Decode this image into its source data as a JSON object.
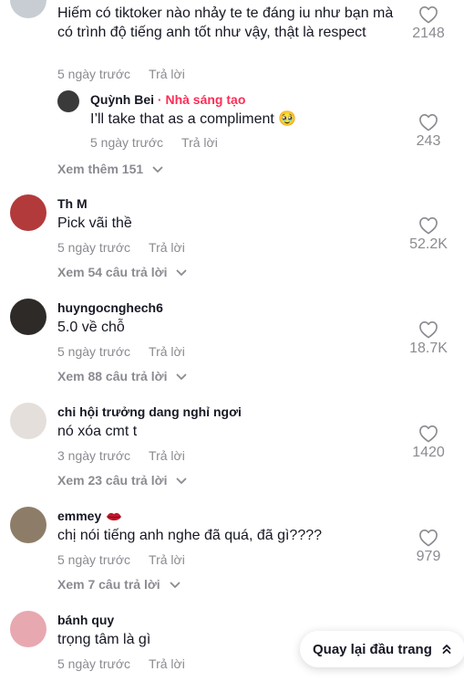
{
  "comments": [
    {
      "text": "Hiếm có tiktoker nào nhảy te te đáng iu như bạn mà có trình độ tiếng anh tốt như vậy, thật là respect",
      "time": "5 ngày trước",
      "reply_label": "Trả lời",
      "likes": "2148",
      "reply": {
        "username": "Quỳnh Bei",
        "separator": "·",
        "creator_badge": "Nhà sáng tạo",
        "text": "I’ll take that as a compliment 🥹",
        "time": "5 ngày trước",
        "reply_label": "Trả lời",
        "likes": "243"
      },
      "view_more": "Xem thêm 151"
    },
    {
      "username": "Th M",
      "text": "Pick vãi thề",
      "time": "5 ngày trước",
      "reply_label": "Trả lời",
      "likes": "52.2K",
      "view_more": "Xem 54 câu trả lời"
    },
    {
      "username": "huyngocnghech6",
      "text": "5.0 về chỗ",
      "time": "5 ngày trước",
      "reply_label": "Trả lời",
      "likes": "18.7K",
      "view_more": "Xem 88 câu trả lời"
    },
    {
      "username": "chi hội trưởng dang nghỉ ngơi",
      "text": "nó xóa cmt t",
      "time": "3 ngày trước",
      "reply_label": "Trả lời",
      "likes": "1420",
      "view_more": "Xem 23 câu trả lời"
    },
    {
      "username": "emmey",
      "text": "chị nói tiếng anh nghe đã quá, đã gì????",
      "time": "5 ngày trước",
      "reply_label": "Trả lời",
      "likes": "979",
      "view_more": "Xem 7 câu trả lời"
    },
    {
      "username": "bánh quy",
      "text": "trọng tâm là gì",
      "time": "5 ngày trước",
      "reply_label": "Trả lời"
    }
  ],
  "back_to_top": "Quay lại đầu trang",
  "icons": {
    "like": "heart-outline-icon",
    "expand": "chevron-down-icon",
    "scroll_top": "double-chevron-up-icon",
    "emoji": "lips-emoji-icon"
  },
  "colors": {
    "text": "#161823",
    "muted": "#8a8b91",
    "creator": "#fe2c55"
  }
}
